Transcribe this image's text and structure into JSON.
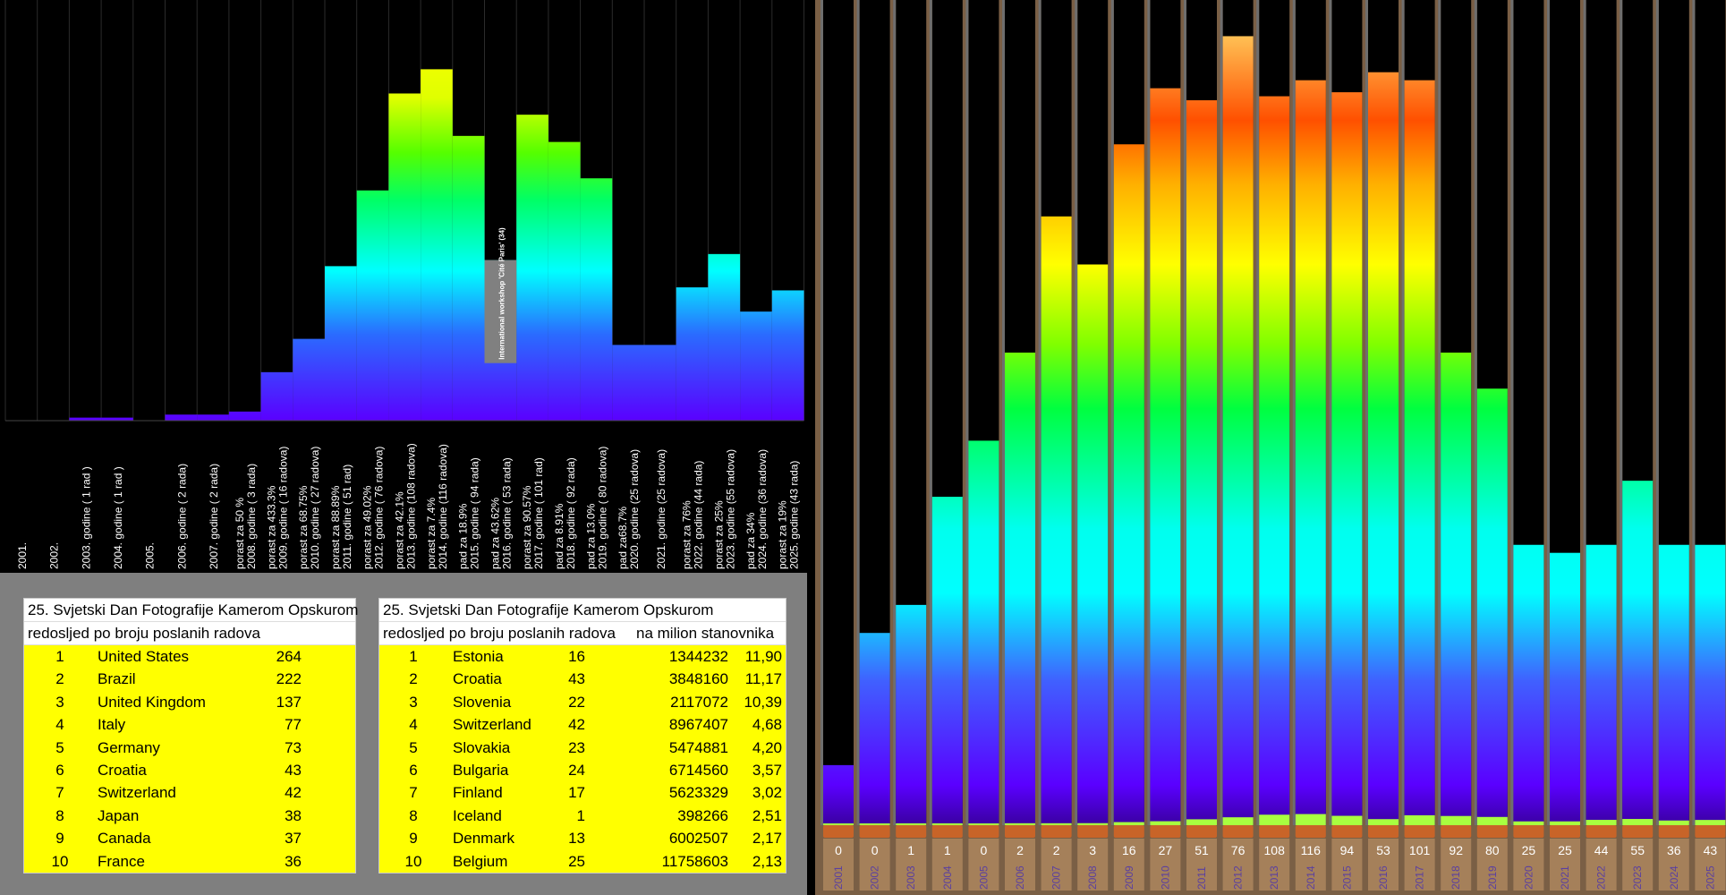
{
  "chart_data": [
    {
      "type": "bar",
      "categories": [
        "2001.",
        "2002.",
        "2003. godine  ( 1 rad )",
        "2004. godine  ( 1 rad )",
        "2005.",
        "2006. godine  ( 2 rada)",
        "2007. godine  ( 2 rada)",
        "porast za 50 %\n2008. godine  ( 3 rada)",
        "porast za 433.3%\n2009. godine  ( 16 radova)",
        "porast za 68.75%\n2010. godine  ( 27 radova)",
        "porast za 88.89%\n2011. godine  ( 51 rad)",
        "porast za 49.02%\n2012. godine  ( 76 radova)",
        "porast za 42.1%\n2013. godine  (108 radova)",
        "porast za 7.4%\n2014. godine  (116 radova)",
        "pad za 18.9%\n2015. godine  ( 94 rada)",
        "pad za 43.62%\n2016. godine  ( 53 rada)",
        "porast za 90.57%\n2017. godine  ( 101 rad)",
        "pad za 8.91%\n2018. godine  ( 92 rada)",
        "pad za 13.0%\n2019. godine  ( 80 radova)",
        "pad za68.7%\n2020. godine  (25 radova)",
        "2021. godine  (25 radova)",
        "porast za 76%\n2022. godine  (44 rada)",
        "porast za 25%\n2023. godine  (55 radova)",
        "pad za 34%\n2024. godine  (36 radova)",
        "porast za 19%\n2025. godine  (43 rada)"
      ],
      "values": [
        0,
        0,
        1,
        1,
        0,
        2,
        2,
        3,
        16,
        27,
        51,
        76,
        108,
        116,
        94,
        53,
        101,
        92,
        80,
        25,
        25,
        44,
        55,
        36,
        43
      ],
      "annotation": "International workshop 'Cité Paris' (34)",
      "annotation_value": 34,
      "annotation_category_index": 15,
      "ylim": [
        0,
        130
      ]
    },
    {
      "type": "bar",
      "categories": [
        "2001",
        "2002",
        "2003",
        "2004",
        "2005",
        "2006",
        "2007",
        "2008",
        "2009",
        "2010",
        "2011",
        "2012",
        "2013",
        "2014",
        "2015",
        "2016",
        "2017",
        "2018",
        "2019",
        "2020",
        "2021",
        "2022",
        "2023",
        "2024",
        "2025"
      ],
      "values": [
        0,
        0,
        1,
        1,
        0,
        2,
        2,
        3,
        16,
        27,
        51,
        76,
        108,
        116,
        94,
        53,
        101,
        92,
        80,
        25,
        25,
        44,
        55,
        36,
        43
      ],
      "relative_heights": [
        0.075,
        0.24,
        0.275,
        0.41,
        0.48,
        0.59,
        0.76,
        0.7,
        0.85,
        0.92,
        0.905,
        0.985,
        0.91,
        0.93,
        0.915,
        0.94,
        0.93,
        0.59,
        0.545,
        0.35,
        0.34,
        0.35,
        0.43,
        0.35,
        0.35
      ],
      "ylim": [
        0,
        1
      ]
    }
  ],
  "table_left": {
    "title": "25. Svjetski Dan Fotografije Kamerom Opskurom",
    "subtitle": "redosljed po broju poslanih radova",
    "rows": [
      {
        "rank": "1",
        "country": "United States",
        "count": "264"
      },
      {
        "rank": "2",
        "country": "Brazil",
        "count": "222"
      },
      {
        "rank": "3",
        "country": "United Kingdom",
        "count": "137"
      },
      {
        "rank": "4",
        "country": "Italy",
        "count": "77"
      },
      {
        "rank": "5",
        "country": "Germany",
        "count": "73"
      },
      {
        "rank": "6",
        "country": "Croatia",
        "count": "43"
      },
      {
        "rank": "7",
        "country": "Switzerland",
        "count": "42"
      },
      {
        "rank": "8",
        "country": "Japan",
        "count": "38"
      },
      {
        "rank": "9",
        "country": "Canada",
        "count": "37"
      },
      {
        "rank": "10",
        "country": "France",
        "count": "36"
      }
    ]
  },
  "table_right": {
    "title": "25. Svjetski Dan Fotografije Kamerom Opskurom",
    "subtitle": "redosljed po broju poslanih radova",
    "subtitle2": "na milion stanovnika",
    "rows": [
      {
        "rank": "1",
        "country": "Estonia",
        "count": "16",
        "population": "1344232",
        "per_million": "11,90"
      },
      {
        "rank": "2",
        "country": "Croatia",
        "count": "43",
        "population": "3848160",
        "per_million": "11,17"
      },
      {
        "rank": "3",
        "country": "Slovenia",
        "count": "22",
        "population": "2117072",
        "per_million": "10,39"
      },
      {
        "rank": "4",
        "country": "Switzerland",
        "count": "42",
        "population": "8967407",
        "per_million": "4,68"
      },
      {
        "rank": "5",
        "country": "Slovakia",
        "count": "23",
        "population": "5474881",
        "per_million": "4,20"
      },
      {
        "rank": "6",
        "country": "Bulgaria",
        "count": "24",
        "population": "6714560",
        "per_million": "3,57"
      },
      {
        "rank": "7",
        "country": "Finland",
        "count": "17",
        "population": "5623329",
        "per_million": "3,02"
      },
      {
        "rank": "8",
        "country": "Iceland",
        "count": "1",
        "population": "398266",
        "per_million": "2,51"
      },
      {
        "rank": "9",
        "country": "Denmark",
        "count": "13",
        "population": "6002507",
        "per_million": "2,17"
      },
      {
        "rank": "10",
        "country": "Belgium",
        "count": "25",
        "population": "11758603",
        "per_million": "2,13"
      }
    ]
  },
  "colors": {
    "table_fill": "#ffff00",
    "table_panel": "#7f7f7f",
    "right_frame": "#7a5f45",
    "annotation_fill": "#808080",
    "label_box": "#a5805a"
  }
}
